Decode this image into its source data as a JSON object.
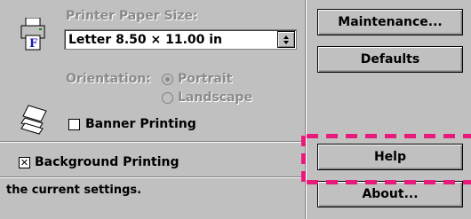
{
  "paper": {
    "label": "Printer Paper Size:",
    "selected": "Letter 8.50 × 11.00 in",
    "icon": "printer-icon"
  },
  "orientation": {
    "label": "Orientation:",
    "options": [
      "Portrait",
      "Landscape"
    ],
    "selected": "Portrait"
  },
  "banner": {
    "label": "Banner Printing",
    "checked": false,
    "icon": "pages-stack-icon"
  },
  "background": {
    "label": "Background Printing",
    "checked": true
  },
  "status": {
    "text": "the current settings."
  },
  "buttons": {
    "maintenance": "Maintenance...",
    "defaults": "Defaults",
    "help": "Help",
    "about": "About..."
  },
  "colors": {
    "face": "#c0c0c0",
    "highlight_annotation": "#e8197a"
  }
}
